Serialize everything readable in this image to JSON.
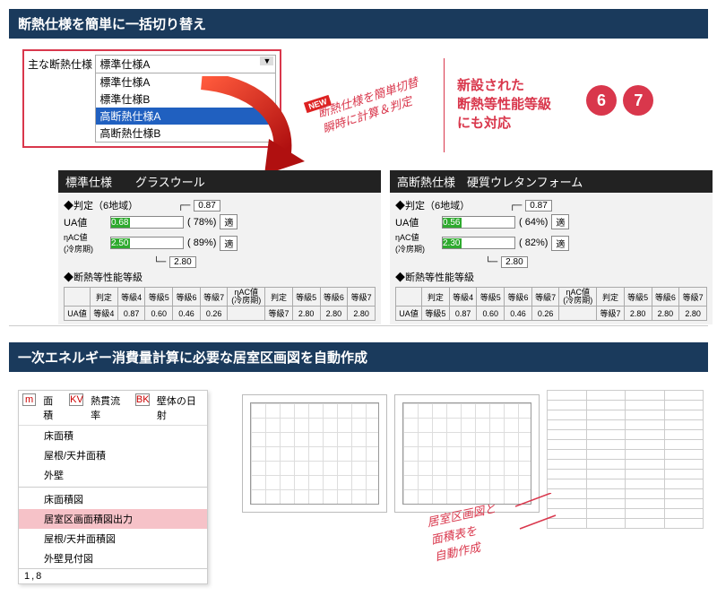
{
  "section1": {
    "title": "断熱仕様を簡単に一括切り替え",
    "dropdown": {
      "label": "主な断熱仕様",
      "selected": "標準仕様A",
      "options": [
        "標準仕様A",
        "標準仕様B",
        "高断熱仕様A",
        "高断熱仕様B"
      ],
      "highlighted_index": 2
    },
    "new_badge": "NEW",
    "callout": "断熱仕様を簡単切替\n瞬時に計算＆判定",
    "right_text": "新設された\n断熱等性能等級\nにも対応",
    "badges": [
      "6",
      "7"
    ],
    "panels": [
      {
        "title": "標準仕様　　グラスウール",
        "judgement_label": "◆判定（6地域）",
        "ref087": "0.87",
        "ua": {
          "label": "UA値",
          "value": "0.68",
          "pct": "( 78%)",
          "pass": "適"
        },
        "nac": {
          "label": "ηAC値\n(冷房期)",
          "value": "2.50",
          "pct": "( 89%)",
          "pass": "適"
        },
        "limit280": "2.80",
        "grade_label": "◆断熱等性能等級",
        "grade_row": {
          "judge": "判定",
          "g4": "等級4",
          "g5": "等級5",
          "g6": "等級6",
          "g7": "等級7",
          "ua_label": "UA値",
          "ua_judge": "等級4",
          "ua4": "0.87",
          "ua5": "0.60",
          "ua6": "0.46",
          "ua7": "0.26",
          "nac_label": "ηAC値\n(冷房期)",
          "nac_judge": "等級7",
          "nac5": "等級5",
          "nac6": "等級6",
          "nac7": "等級7",
          "nv5": "2.80",
          "nv6": "2.80",
          "nv7": "2.80"
        }
      },
      {
        "title": "高断熱仕様　硬質ウレタンフォーム",
        "judgement_label": "◆判定（6地域）",
        "ref087": "0.87",
        "ua": {
          "label": "UA値",
          "value": "0.56",
          "pct": "( 64%)",
          "pass": "適"
        },
        "nac": {
          "label": "ηAC値\n(冷房期)",
          "value": "2.30",
          "pct": "( 82%)",
          "pass": "適"
        },
        "limit280": "2.80",
        "grade_label": "◆断熱等性能等級",
        "grade_row": {
          "judge": "判定",
          "g4": "等級4",
          "g5": "等級5",
          "g6": "等級6",
          "g7": "等級7",
          "ua_label": "UA値",
          "ua_judge": "等級5",
          "ua4": "0.87",
          "ua5": "0.60",
          "ua6": "0.46",
          "ua7": "0.26",
          "nac_label": "ηAC値\n(冷房期)",
          "nac_judge": "等級7",
          "nac5": "等級5",
          "nac6": "等級6",
          "nac7": "等級7",
          "nv5": "2.80",
          "nv6": "2.80",
          "nv7": "2.80"
        }
      }
    ]
  },
  "section2": {
    "title": "一次エネルギー消費量計算に必要な居室区画図を自動作成",
    "menu": {
      "top_tabs": [
        "面積",
        "熱貫流率",
        "壁体の日射"
      ],
      "top_icons": [
        "m",
        "KV",
        "BK"
      ],
      "items": [
        "床面積",
        "屋根/天井面積",
        "外壁",
        "床面積図",
        "居室区画面積図出力",
        "屋根/天井面積図",
        "外壁見付図"
      ],
      "selected_index": 4,
      "bottom": "1,8"
    },
    "callout": "居室区画図と\n面積表を\n自動作成"
  }
}
